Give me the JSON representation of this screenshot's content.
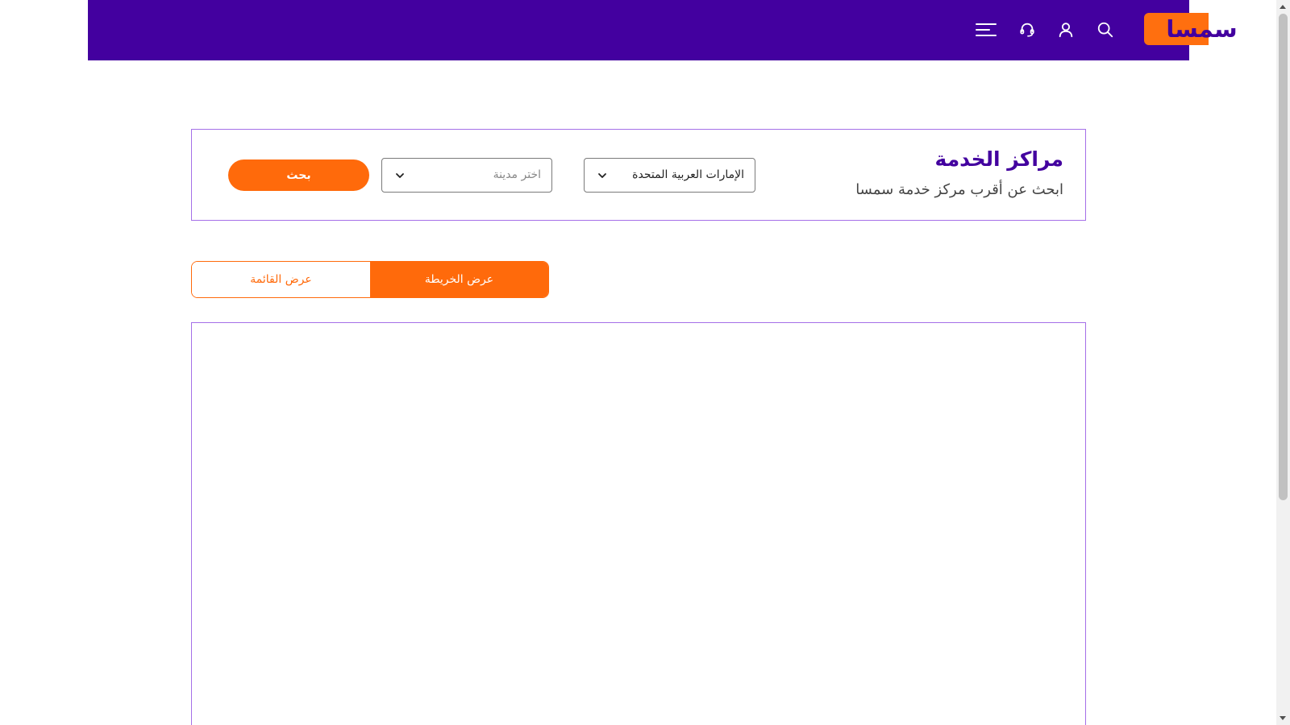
{
  "header": {
    "logo_text": "سمسا",
    "icons": [
      "search-icon",
      "user-icon",
      "support-headset-icon",
      "menu-icon"
    ]
  },
  "search": {
    "title": "مراكز الخدمة",
    "subtitle": "ابحث عن أقرب مركز خدمة سمسا",
    "country_value": "الإمارات العربية المتحدة",
    "city_placeholder": "اختر مدينة",
    "button_label": "بحث"
  },
  "view": {
    "map_label": "عرض الخريطة",
    "list_label": "عرض القائمة",
    "active": "map"
  },
  "colors": {
    "brand_purple": "#43009f",
    "brand_orange": "#ff6a0b",
    "card_border": "#a570e8"
  }
}
